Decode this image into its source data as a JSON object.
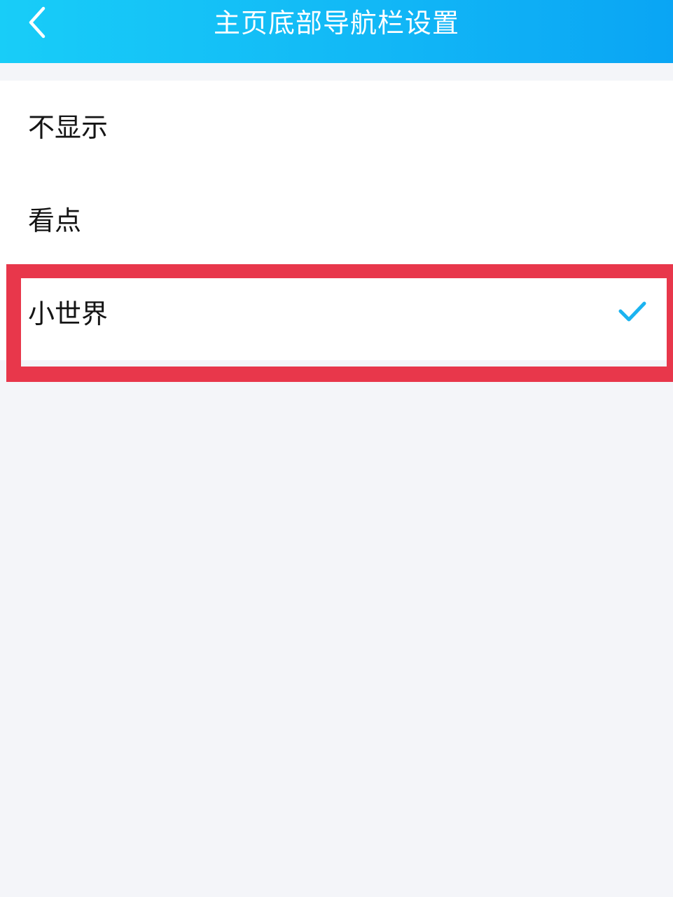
{
  "header": {
    "title": "主页底部导航栏设置",
    "back_icon": "chevron-left-icon",
    "gradient_colors": [
      "#18cdf8",
      "#0aa5f4"
    ]
  },
  "options": [
    {
      "label": "不显示",
      "selected": false
    },
    {
      "label": "看点",
      "selected": false
    },
    {
      "label": "小世界",
      "selected": true
    }
  ],
  "check_icon": "checkmark-icon",
  "colors": {
    "accent": "#1bb3f0",
    "highlight": "#e8374b",
    "background": "#f4f5f9"
  }
}
